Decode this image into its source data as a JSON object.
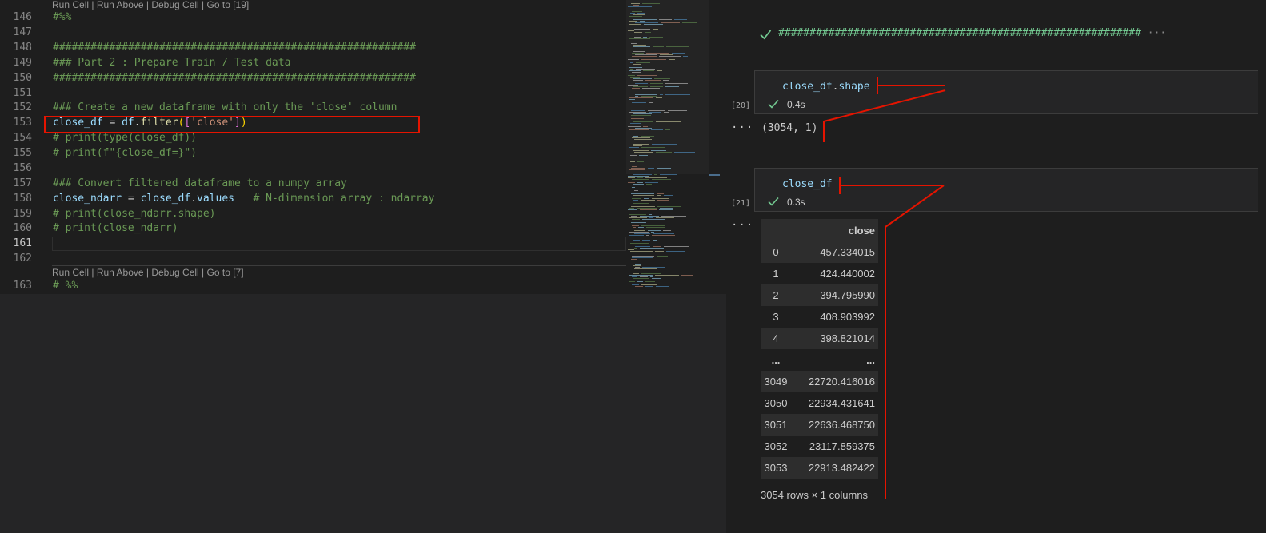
{
  "codelens": {
    "top": {
      "run_cell": "Run Cell",
      "run_above": "Run Above",
      "debug_cell": "Debug Cell",
      "goto": "Go to [19]",
      "sep": " | "
    },
    "bottom": {
      "run_cell": "Run Cell",
      "run_above": "Run Above",
      "debug_cell": "Debug Cell",
      "goto": "Go to [7]",
      "sep": " | "
    }
  },
  "editor": {
    "line_numbers": [
      "146",
      "147",
      "148",
      "149",
      "150",
      "151",
      "152",
      "153",
      "154",
      "155",
      "156",
      "157",
      "158",
      "159",
      "160",
      "161",
      "162",
      "163"
    ],
    "lines": {
      "l146": "#%%",
      "l148": "##########################################################",
      "l149": "### Part 2 : Prepare Train / Test data",
      "l150": "##########################################################",
      "l152": "### Create a new dataframe with only the 'close' column",
      "l153": {
        "var": "close_df",
        "eq": " = ",
        "obj": "df",
        "dot": ".",
        "fn": "filter",
        "p1": "(",
        "b1": "[",
        "str": "'close'",
        "b2": "]",
        "p2": ")"
      },
      "l154": "# print(type(close_df))",
      "l155": "# print(f\"{close_df=}\")",
      "l157": "### Convert filtered dataframe to a numpy array",
      "l158": {
        "var": "close_ndarr",
        "eq": " = ",
        "obj": "close_df",
        "dot": ".",
        "attr": "values",
        "comment": "   # N-dimension array : ndarray"
      },
      "l159": "# print(close_ndarr.shape)",
      "l160": "# print(close_ndarr)",
      "l163": "# %%"
    }
  },
  "notebook": {
    "prev_output": {
      "text": "##########################################################",
      "more": "···"
    },
    "cell20": {
      "exec_count": "[20]",
      "code_var": "close_df",
      "code_dot": ".",
      "code_attr": "shape",
      "time": "0.4s",
      "output_menu": "···",
      "output": "(3054, 1)"
    },
    "cell21": {
      "exec_count": "[21]",
      "code_var": "close_df",
      "time": "0.3s",
      "output_menu": "···",
      "table": {
        "header": [
          "",
          "close"
        ],
        "rows": [
          [
            "0",
            "457.334015"
          ],
          [
            "1",
            "424.440002"
          ],
          [
            "2",
            "394.795990"
          ],
          [
            "3",
            "408.903992"
          ],
          [
            "4",
            "398.821014"
          ],
          [
            "...",
            "..."
          ],
          [
            "3049",
            "22720.416016"
          ],
          [
            "3050",
            "22934.431641"
          ],
          [
            "3051",
            "22636.468750"
          ],
          [
            "3052",
            "23117.859375"
          ],
          [
            "3053",
            "22913.482422"
          ]
        ]
      },
      "summary": "3054 rows × 1 columns"
    }
  },
  "colors": {
    "editor_bg": "#1e1e1e",
    "comment": "#6a9955",
    "variable": "#9cdcfe",
    "function": "#dcdcaa",
    "string": "#ce9178",
    "success": "#73c991",
    "annotation_red": "#e51400"
  },
  "icons": {
    "success": "check-icon"
  }
}
